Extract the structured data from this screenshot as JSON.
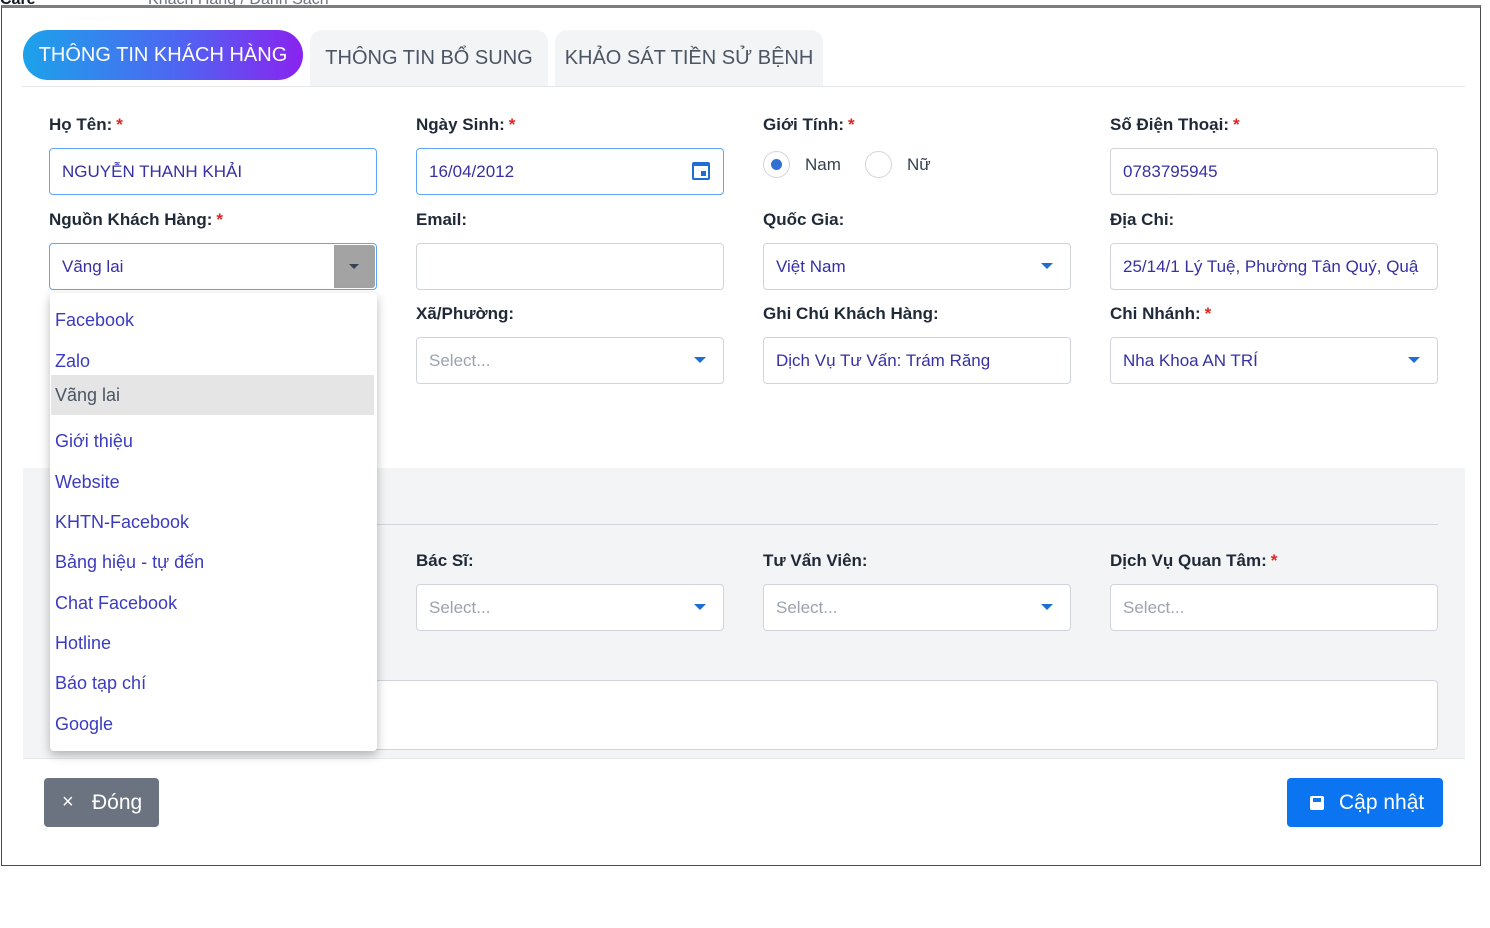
{
  "background": {
    "logo": "Care",
    "breadcrumb": "Khách Hàng / Danh Sách"
  },
  "tabs": [
    {
      "label": "THÔNG TIN KHÁCH HÀNG",
      "active": true
    },
    {
      "label": "THÔNG TIN BỔ SUNG",
      "active": false
    },
    {
      "label": "KHẢO SÁT TIỀN SỬ BỆNH",
      "active": false
    }
  ],
  "form": {
    "required_mark": "*",
    "full_name": {
      "label": "Họ Tên:",
      "value": "NGUYỄN THANH KHẢI"
    },
    "birth_date": {
      "label": "Ngày Sinh:",
      "value": "16/04/2012"
    },
    "gender": {
      "label": "Giới Tính:",
      "options": [
        "Nam",
        "Nữ"
      ],
      "selected": "Nam"
    },
    "phone": {
      "label": "Số Điện Thoại:",
      "value": "0783795945"
    },
    "source": {
      "label": "Nguồn Khách Hàng:",
      "value": "Vãng lai"
    },
    "email": {
      "label": "Email:",
      "value": ""
    },
    "country": {
      "label": "Quốc Gia:",
      "value": "Việt Nam"
    },
    "address": {
      "label": "Địa Chi:",
      "value": "25/14/1 Lý Tuệ, Phường Tân Quý, Quậ"
    },
    "ward": {
      "label": "Xã/Phường:",
      "placeholder": "Select..."
    },
    "customer_note": {
      "label": "Ghi Chú Khách Hàng:",
      "value": "Dịch Vụ Tư Vấn: Trám Răng"
    },
    "branch": {
      "label": "Chi Nhánh:",
      "value": "Nha Khoa AN TRÍ"
    }
  },
  "section2": {
    "doctor": {
      "label": "Bác Sĩ:",
      "placeholder": "Select..."
    },
    "consultant": {
      "label": "Tư Vấn Viên:",
      "placeholder": "Select..."
    },
    "service": {
      "label": "Dịch Vụ Quan Tâm:",
      "placeholder": "Select..."
    }
  },
  "source_dropdown": {
    "options": [
      "Facebook",
      "Zalo",
      "Vãng lai",
      "Giới thiệu",
      "Website",
      "KHTN-Facebook",
      "Bảng hiệu - tự đến",
      "Chat Facebook",
      "Hotline",
      "Báo tạp chí",
      "Google"
    ],
    "selected": "Vãng lai"
  },
  "footer": {
    "close_label": "Đóng",
    "close_icon": "×",
    "save_label": "Cập nhật"
  },
  "colors": {
    "accent": "#0b74f0",
    "tab_gradient_start": "#1ca2ea",
    "tab_gradient_end": "#8a23ef",
    "option_text": "#3b3bbf"
  }
}
